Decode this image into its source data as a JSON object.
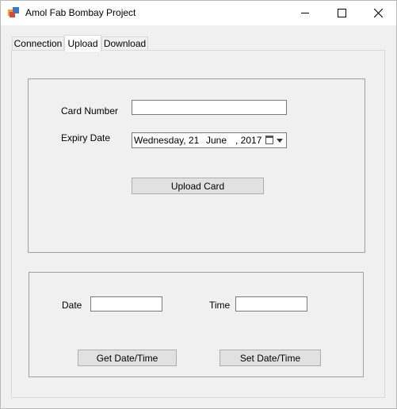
{
  "window": {
    "title": "Amol Fab Bombay Project",
    "controls": {
      "minimize": "minimize",
      "maximize": "maximize",
      "close": "close"
    }
  },
  "tabs": [
    {
      "label": "Connection",
      "active": false
    },
    {
      "label": "Upload",
      "active": true
    },
    {
      "label": "Download",
      "active": false
    }
  ],
  "card_group": {
    "card_number_label": "Card Number",
    "card_number_value": "",
    "expiry_label": "Expiry Date",
    "expiry": {
      "weekday": "Wednesday, 21",
      "month": "June",
      "year": ", 2017"
    },
    "upload_button": "Upload Card"
  },
  "datetime_group": {
    "date_label": "Date",
    "date_value": "",
    "time_label": "Time",
    "time_value": "",
    "get_button": "Get Date/Time",
    "set_button": "Set Date/Time"
  }
}
